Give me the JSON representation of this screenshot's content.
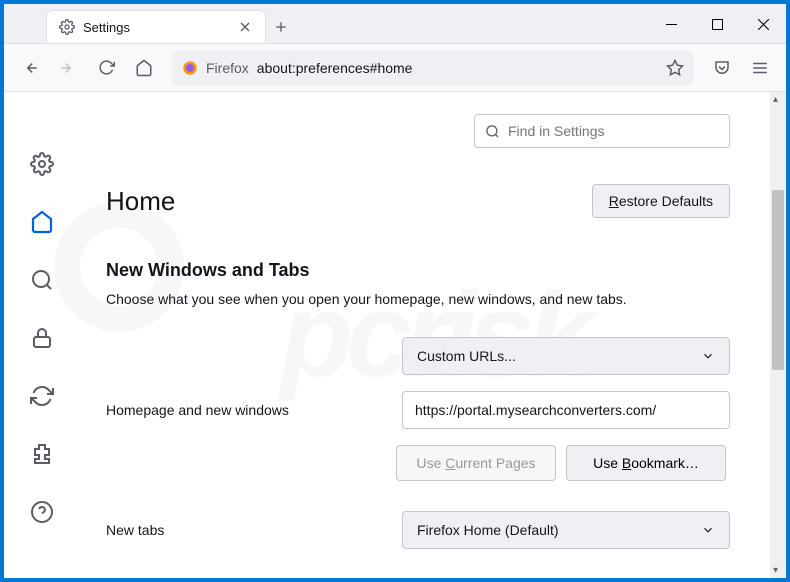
{
  "tab": {
    "title": "Settings"
  },
  "urlbar": {
    "prefix": "Firefox",
    "path": "about:preferences#home"
  },
  "search": {
    "placeholder": "Find in Settings"
  },
  "page": {
    "title": "Home"
  },
  "buttons": {
    "restore": "Restore Defaults",
    "restore_u": "R",
    "use_current": "Use Current Pages",
    "use_current_u": "C",
    "use_bookmark": "Use Bookmark…",
    "use_bookmark_u": "B"
  },
  "section": {
    "title": "New Windows and Tabs",
    "desc": "Choose what you see when you open your homepage, new windows, and new tabs."
  },
  "homepage": {
    "label": "Homepage and new windows",
    "select": "Custom URLs...",
    "value": "https://portal.mysearchconverters.com/"
  },
  "newtabs": {
    "label": "New tabs",
    "select": "Firefox Home (Default)"
  }
}
